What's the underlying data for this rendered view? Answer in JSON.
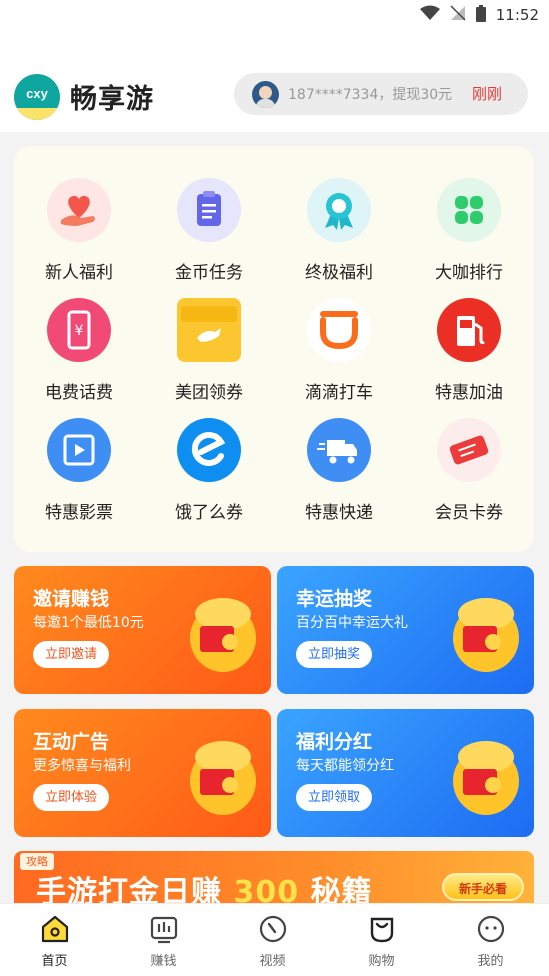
{
  "status_bar": {
    "time": "11:52"
  },
  "header": {
    "app_name": "畅享游",
    "ticker": {
      "text": "187****7334，提现30元",
      "time": "刚刚"
    }
  },
  "grid": [
    {
      "label": "新人福利",
      "icon": "heart-hand-icon"
    },
    {
      "label": "金币任务",
      "icon": "clipboard-icon"
    },
    {
      "label": "终极福利",
      "icon": "medal-icon"
    },
    {
      "label": "大咖排行",
      "icon": "clover-icon"
    },
    {
      "label": "电费话费",
      "icon": "phone-yuan-icon"
    },
    {
      "label": "美团领券",
      "icon": "meituan-kangaroo-icon"
    },
    {
      "label": "滴滴打车",
      "icon": "didi-icon"
    },
    {
      "label": "特惠加油",
      "icon": "fuel-pump-icon"
    },
    {
      "label": "特惠影票",
      "icon": "film-icon"
    },
    {
      "label": "饿了么券",
      "icon": "eleme-icon"
    },
    {
      "label": "特惠快递",
      "icon": "delivery-truck-icon"
    },
    {
      "label": "会员卡券",
      "icon": "ticket-icon"
    }
  ],
  "promos": [
    {
      "title": "邀请赚钱",
      "subtitle": "每邀1个最低10元",
      "button": "立即邀请",
      "theme": "orange"
    },
    {
      "title": "幸运抽奖",
      "subtitle": "百分百中幸运大礼",
      "button": "立即抽奖",
      "theme": "blue"
    },
    {
      "title": "互动广告",
      "subtitle": "更多惊喜与福利",
      "button": "立即体验",
      "theme": "orange"
    },
    {
      "title": "福利分红",
      "subtitle": "每天都能领分红",
      "button": "立即领取",
      "theme": "blue"
    }
  ],
  "banner": {
    "tag": "攻略",
    "text_before": "手游打金日赚 ",
    "number": "300",
    "text_after": " 秘籍",
    "button": "新手必看"
  },
  "nav": [
    {
      "label": "首页",
      "icon": "home-icon",
      "active": true
    },
    {
      "label": "赚钱",
      "icon": "chart-icon",
      "active": false
    },
    {
      "label": "视频",
      "icon": "video-dial-icon",
      "active": false
    },
    {
      "label": "购物",
      "icon": "shopping-bag-icon",
      "active": false
    },
    {
      "label": "我的",
      "icon": "profile-face-icon",
      "active": false
    }
  ],
  "colors": {
    "accent_orange": "#ff5a17",
    "accent_blue": "#1d6cf2",
    "ticker_time": "#e53935",
    "brand_teal": "#0fa6a0"
  }
}
